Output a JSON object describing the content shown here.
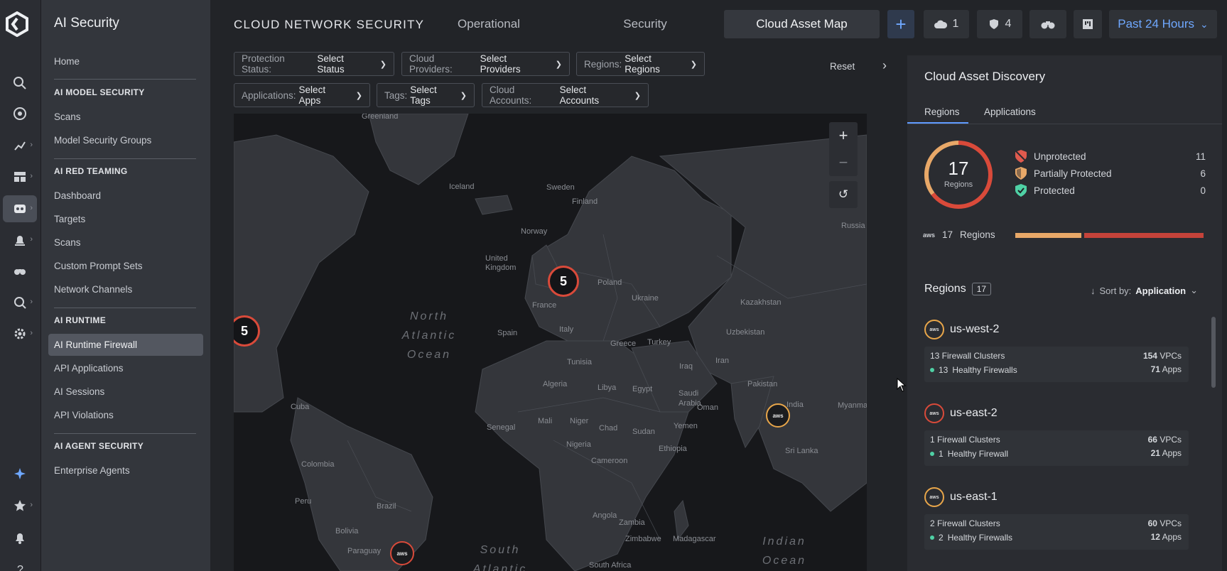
{
  "app": {
    "section_title": "AI Security"
  },
  "nav": {
    "home": "Home",
    "sections": [
      {
        "title": "AI MODEL SECURITY",
        "items": [
          "Scans",
          "Model Security Groups"
        ]
      },
      {
        "title": "AI RED TEAMING",
        "items": [
          "Dashboard",
          "Targets",
          "Scans",
          "Custom Prompt Sets",
          "Network Channels"
        ]
      },
      {
        "title": "AI RUNTIME",
        "items": [
          "AI Runtime Firewall",
          "API Applications",
          "AI Sessions",
          "API Violations"
        ]
      },
      {
        "title": "AI AGENT SECURITY",
        "items": [
          "Enterprise Agents"
        ]
      }
    ],
    "active_item": "AI Runtime Firewall"
  },
  "header": {
    "title": "CLOUD NETWORK SECURITY",
    "tabs": [
      "Operational",
      "Security",
      "Cloud Asset Map"
    ],
    "active_tab": "Cloud Asset Map",
    "cloud_count": "1",
    "shield_count": "4",
    "time_range": "Past 24 Hours"
  },
  "filters": [
    {
      "key": "Protection Status:",
      "value": "Select Status"
    },
    {
      "key": "Cloud Providers:",
      "value": "Select Providers"
    },
    {
      "key": "Regions:",
      "value": "Select Regions"
    },
    {
      "key": "Applications:",
      "value": "Select Apps"
    },
    {
      "key": "Tags:",
      "value": "Select Tags"
    },
    {
      "key": "Cloud Accounts:",
      "value": "Select Accounts"
    }
  ],
  "reset_label": "Reset",
  "map": {
    "land_labels": [
      "Greenland",
      "Iceland",
      "Sweden",
      "Finland",
      "Norway",
      "United Kingdom",
      "Poland",
      "Ukraine",
      "France",
      "Spain",
      "Italy",
      "Greece",
      "Turkey",
      "Tunisia",
      "Algeria",
      "Libya",
      "Egypt",
      "Saudi Arabia",
      "Oman",
      "Yemen",
      "Iraq",
      "Iran",
      "Kazakhstan",
      "Uzbekistan",
      "Pakistan",
      "India",
      "Sri Lanka",
      "Myanmar",
      "Russia",
      "Cuba",
      "Senegal",
      "Mali",
      "Niger",
      "Chad",
      "Sudan",
      "Ethiopia",
      "Nigeria",
      "Cameroon",
      "Colombia",
      "Peru",
      "Brazil",
      "Bolivia",
      "Paraguay",
      "Angola",
      "Zambia",
      "Zimbabwe",
      "Madagascar",
      "South Africa"
    ],
    "ocean_labels": [
      {
        "line1": "North",
        "line2": "Atlantic",
        "line3": "Ocean"
      },
      {
        "line1": "South",
        "line2": "Atlantic",
        "line3": ""
      },
      {
        "line1": "Indian",
        "line2": "Ocean",
        "line3": ""
      }
    ],
    "clusters": [
      "5",
      "5"
    ],
    "aws_marker_text": "aws"
  },
  "panel": {
    "title": "Cloud Asset Discovery",
    "tabs": [
      "Regions",
      "Applications"
    ],
    "active_tab": "Regions",
    "donut": {
      "total": "17",
      "label": "Regions",
      "unprotected": 11,
      "partially": 6,
      "protected": 0
    },
    "legend": [
      {
        "name": "Unprotected",
        "count": "11"
      },
      {
        "name": "Partially Protected",
        "count": "6"
      },
      {
        "name": "Protected",
        "count": "0"
      }
    ],
    "provider_row": {
      "count": "17",
      "label": "Regions"
    },
    "regions_header": "Regions",
    "regions_count": "17",
    "sort_label": "Sort by:",
    "sort_value": "Application",
    "regions": [
      {
        "name": "us-west-2",
        "status": "partial",
        "clusters": "13 Firewall Clusters",
        "healthy_count": "13",
        "healthy_label": "Healthy Firewalls",
        "vpcs_num": "154",
        "vpcs_label": "VPCs",
        "apps_num": "71",
        "apps_label": "Apps"
      },
      {
        "name": "us-east-2",
        "status": "unprotected",
        "clusters": "1 Firewall Clusters",
        "healthy_count": "1",
        "healthy_label": "Healthy Firewall",
        "vpcs_num": "66",
        "vpcs_label": "VPCs",
        "apps_num": "21",
        "apps_label": "Apps"
      },
      {
        "name": "us-east-1",
        "status": "partial",
        "clusters": "2 Firewall Clusters",
        "healthy_count": "2",
        "healthy_label": "Healthy Firewalls",
        "vpcs_num": "60",
        "vpcs_label": "VPCs",
        "apps_num": "12",
        "apps_label": "Apps"
      }
    ]
  },
  "colors": {
    "accent": "#6fa8ff",
    "unprotected": "#d94a3a",
    "partial": "#e8a868",
    "protected": "#4fd1a5"
  }
}
